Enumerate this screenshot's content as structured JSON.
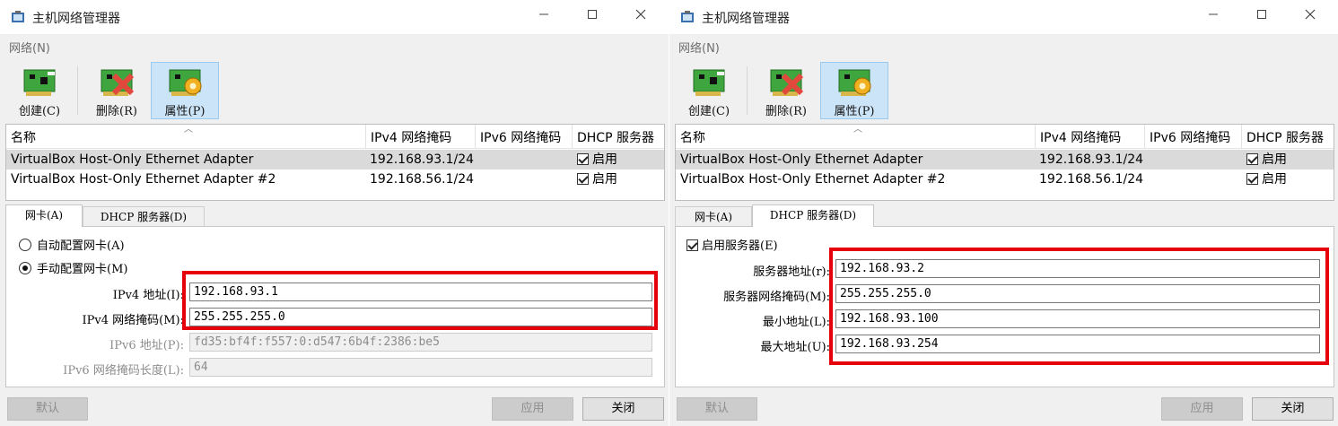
{
  "left": {
    "title": "主机网络管理器",
    "menu": "网络(N)",
    "toolbar": {
      "create": "创建(C)",
      "delete": "删除(R)",
      "props": "属性(P)"
    },
    "columns": [
      "名称",
      "IPv4 网络掩码",
      "IPv6 网络掩码",
      "DHCP 服务器"
    ],
    "rows": [
      {
        "name": "VirtualBox Host-Only Ethernet Adapter",
        "ipv4": "192.168.93.1/24",
        "dhcp": "启用"
      },
      {
        "name": "VirtualBox Host-Only Ethernet Adapter #2",
        "ipv4": "192.168.56.1/24",
        "dhcp": "启用"
      }
    ],
    "tabs": {
      "adapter": "网卡(A)",
      "dhcp": "DHCP 服务器(D)"
    },
    "adapter": {
      "auto": "自动配置网卡(A)",
      "manual": "手动配置网卡(M)",
      "ipv4_addr_label": "IPv4 地址(I):",
      "ipv4_addr": "192.168.93.1",
      "ipv4_mask_label": "IPv4 网络掩码(M):",
      "ipv4_mask": "255.255.255.0",
      "ipv6_addr_label": "IPv6 地址(P):",
      "ipv6_addr": "fd35:bf4f:f557:0:d547:6b4f:2386:be5",
      "ipv6_len_label": "IPv6 网络掩码长度(L):",
      "ipv6_len": "64"
    },
    "buttons": {
      "default": "默认",
      "apply": "应用",
      "close": "关闭"
    }
  },
  "right": {
    "title": "主机网络管理器",
    "menu": "网络(N)",
    "toolbar": {
      "create": "创建(C)",
      "delete": "删除(R)",
      "props": "属性(P)"
    },
    "columns": [
      "名称",
      "IPv4 网络掩码",
      "IPv6 网络掩码",
      "DHCP 服务器"
    ],
    "rows": [
      {
        "name": "VirtualBox Host-Only Ethernet Adapter",
        "ipv4": "192.168.93.1/24",
        "dhcp": "启用"
      },
      {
        "name": "VirtualBox Host-Only Ethernet Adapter #2",
        "ipv4": "192.168.56.1/24",
        "dhcp": "启用"
      }
    ],
    "tabs": {
      "adapter": "网卡(A)",
      "dhcp": "DHCP 服务器(D)"
    },
    "dhcp": {
      "enable": "启用服务器(E)",
      "server_addr_label": "服务器地址(r):",
      "server_addr": "192.168.93.2",
      "server_mask_label": "服务器网络掩码(M):",
      "server_mask": "255.255.255.0",
      "lower_label": "最小地址(L):",
      "lower": "192.168.93.100",
      "upper_label": "最大地址(U):",
      "upper": "192.168.93.254"
    },
    "buttons": {
      "default": "默认",
      "apply": "应用",
      "close": "关闭"
    }
  },
  "colors": {
    "highlight": "#e6000b",
    "selected_row": "#dadada",
    "active_tool": "#cce4f7"
  },
  "icons": [
    "virtualbox-app-icon",
    "network-card-create-icon",
    "network-card-delete-icon",
    "network-card-properties-icon"
  ]
}
